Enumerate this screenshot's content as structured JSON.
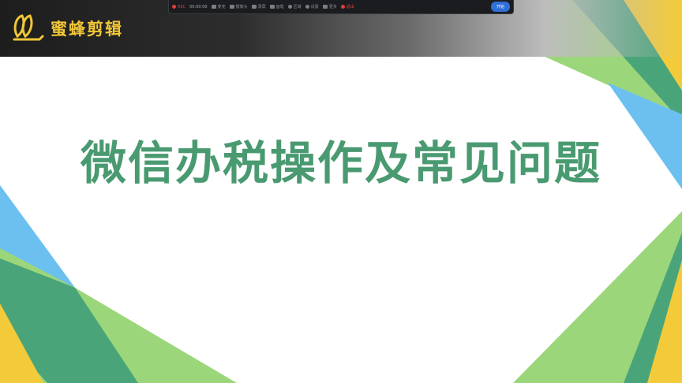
{
  "brand": {
    "name": "蜜蜂剪辑",
    "logo_icon": "bee-logo-icon",
    "accent_color": "#f1c638"
  },
  "recorder_toolbar": {
    "record_label": "REC",
    "timer": "00:00:00",
    "items": [
      {
        "label": "麦克",
        "icon": "microphone-icon"
      },
      {
        "label": "摄像头",
        "icon": "camera-icon"
      },
      {
        "label": "录屏",
        "icon": "screen-icon"
      },
      {
        "label": "画笔",
        "icon": "pen-icon"
      },
      {
        "label": "区域",
        "icon": "region-icon"
      },
      {
        "label": "设置",
        "icon": "settings-icon"
      },
      {
        "label": "更多",
        "icon": "more-icon"
      }
    ],
    "exit_label": "退出",
    "start_label": "开始"
  },
  "slide": {
    "title": "微信办税操作及常见问题",
    "title_color": "#4a9a71",
    "shape_colors": [
      "#f3cb3a",
      "#4aa47a",
      "#9cd67a",
      "#6cc0f0"
    ]
  }
}
